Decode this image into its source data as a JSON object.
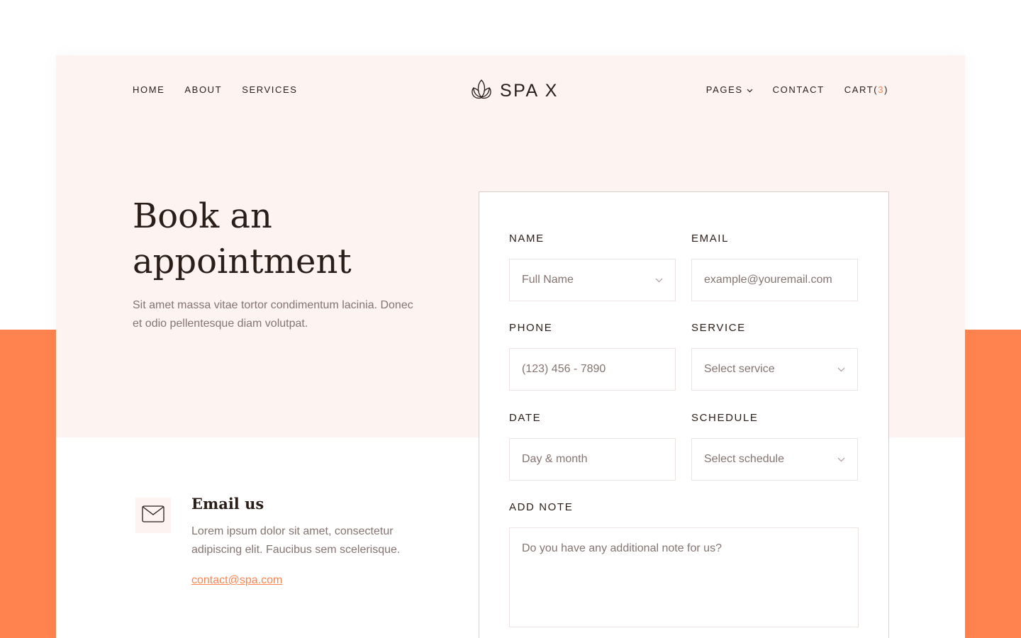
{
  "nav": {
    "left": [
      "HOME",
      "ABOUT",
      "SERVICES"
    ],
    "pages_label": "PAGES",
    "contact_label": "CONTACT",
    "cart_label": "CART",
    "cart_open": " (",
    "cart_count": "3",
    "cart_close": ")"
  },
  "logo": {
    "text": "SPA X",
    "icon": "lotus-icon"
  },
  "hero": {
    "title": "Book an appointment",
    "description": "Sit amet massa vitae tortor condimentum lacinia. Donec et odio pellentesque diam volutpat."
  },
  "email_us": {
    "title": "Email us",
    "description": "Lorem ipsum dolor sit amet, consectetur adipiscing elit. Faucibus sem scelerisque.",
    "link": "contact@spa.com",
    "icon": "envelope-icon"
  },
  "form": {
    "name": {
      "label": "NAME",
      "placeholder": "Full Name"
    },
    "email": {
      "label": "EMAIL",
      "placeholder": "example@youremail.com"
    },
    "phone": {
      "label": "PHONE",
      "placeholder": "(123) 456 - 7890"
    },
    "service": {
      "label": "SERVICE",
      "placeholder": "Select service"
    },
    "date": {
      "label": "DATE",
      "placeholder": "Day & month"
    },
    "schedule": {
      "label": "SCHEDULE",
      "placeholder": "Select schedule"
    },
    "note": {
      "label": "ADD NOTE",
      "placeholder": "Do you have any additional note for us?"
    }
  },
  "colors": {
    "accent": "#ff834e",
    "hero_bg": "#fdf4f1",
    "text_dark": "#2b1d18",
    "text_muted": "#857470"
  }
}
